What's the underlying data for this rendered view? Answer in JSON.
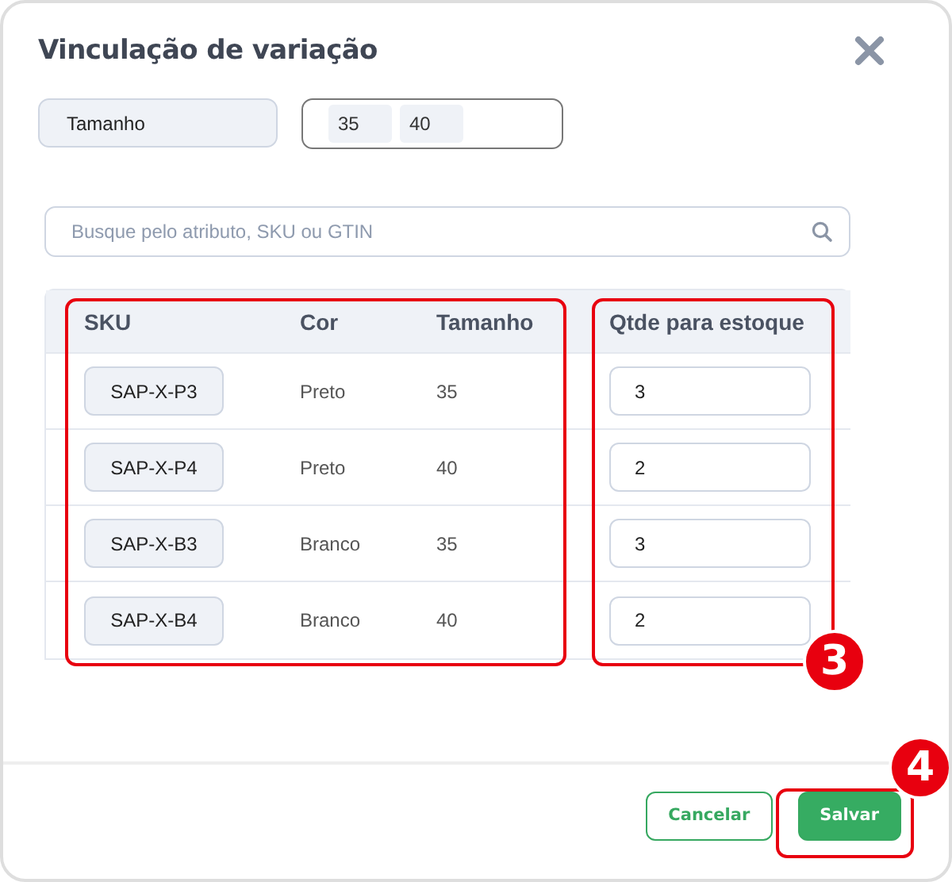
{
  "dialog": {
    "title": "Vinculação de variação"
  },
  "attribute": {
    "name": "Tamanho",
    "values": [
      "35",
      "40"
    ]
  },
  "search": {
    "placeholder": "Busque pelo atributo, SKU ou GTIN"
  },
  "table": {
    "columns": [
      "SKU",
      "Cor",
      "Tamanho",
      "Qtde para estoque"
    ],
    "rows": [
      {
        "sku": "SAP-X-P3",
        "cor": "Preto",
        "tamanho": "35",
        "qtde": "3"
      },
      {
        "sku": "SAP-X-P4",
        "cor": "Preto",
        "tamanho": "40",
        "qtde": "2"
      },
      {
        "sku": "SAP-X-B3",
        "cor": "Branco",
        "tamanho": "35",
        "qtde": "3"
      },
      {
        "sku": "SAP-X-B4",
        "cor": "Branco",
        "tamanho": "40",
        "qtde": "2"
      }
    ],
    "callout": "3"
  },
  "footer": {
    "cancel": "Cancelar",
    "save": "Salvar",
    "callout": "4"
  }
}
